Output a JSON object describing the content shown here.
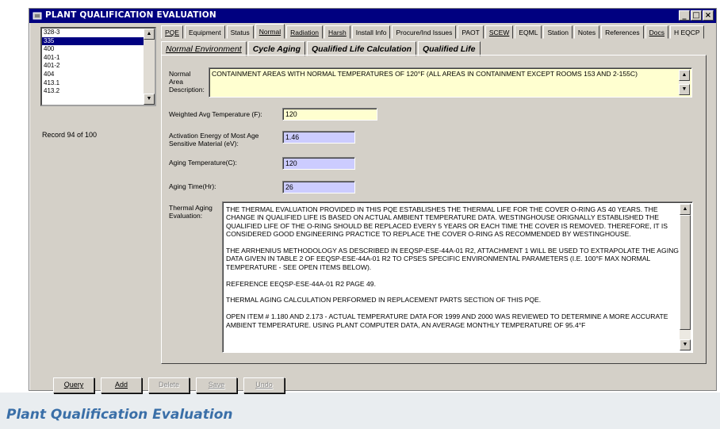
{
  "window": {
    "title": "PLANT QUALIFICATION EVALUATION",
    "controls": [
      "_",
      "□",
      "×"
    ]
  },
  "record_list": {
    "items": [
      "328-3",
      "335",
      "400",
      "401-1",
      "401-2",
      "404",
      "413.1",
      "413.2"
    ],
    "selected_index": 1,
    "record_status": "Record 94 of 100"
  },
  "tabs": [
    "PQE",
    "Equipment",
    "Status",
    "Normal",
    "Radiation",
    "Harsh",
    "Install Info",
    "Procure/Ind Issues",
    "PAOT",
    "SCEW",
    "EQML",
    "Station",
    "Notes",
    "References",
    "Docs",
    "H EQCP"
  ],
  "active_tab": "Normal",
  "subtabs": [
    "Normal Environment",
    "Cycle Aging",
    "Qualified Life Calculation",
    "Qualified Life"
  ],
  "active_subtab": "Normal Environment",
  "form": {
    "area_label": "Normal Area Description:",
    "area_value": "CONTAINMENT AREAS WITH NORMAL TEMPERATURES OF 120°F (ALL AREAS IN CONTAINMENT EXCEPT ROOMS 153 AND 2-155C)",
    "wavg_label": "Weighted Avg Temperature (F):",
    "wavg_value": "120",
    "activation_label_1": "Activation Energy of Most Age",
    "activation_label_2": "Sensitive Material (eV):",
    "activation_value": "1.46",
    "aging_temp_label": "Aging Temperature(C):",
    "aging_temp_value": "120",
    "aging_time_label": "Aging Time(Hr):",
    "aging_time_value": "26",
    "thermal_label_1": "Thermal Aging",
    "thermal_label_2": "Evaluation:",
    "thermal_paragraphs": [
      "THE THERMAL EVALUATION PROVIDED IN THIS PQE ESTABLISHES THE THERMAL LIFE FOR THE COVER O-RING AS 40 YEARS. THE CHANGE IN QUALIFIED LIFE IS BASED ON ACTUAL AMBIENT TEMPERATURE DATA.  WESTINGHOUSE ORIGNALLY ESTABLISHED THE QUALIFIED LIFE OF THE O-RING SHOULD BE REPLACED EVERY 5 YEARS OR EACH TIME THE COVER IS REMOVED. THEREFORE, IT IS CONSIDERED GOOD ENGINEERING PRACTICE TO REPLACE THE COVER O-RING AS RECOMMENDED BY WESTINGHOUSE.",
      "THE ARRHENIUS METHODOLOGY AS DESCRIBED IN EEQSP-ESE-44A-01 R2, ATTACHMENT 1 WILL BE USED TO EXTRAPOLATE THE AGING DATA GIVEN IN TABLE 2 OF EEQSP-ESE-44A-01 R2 TO CPSES SPECIFIC ENVIRONMENTAL PARAMETERS (I.E. 100°F MAX NORMAL TEMPERATURE - SEE OPEN ITEMS BELOW).",
      "REFERENCE EEQSP-ESE-44A-01 R2 PAGE 49.",
      "THERMAL AGING CALCULATION PERFORMED IN REPLACEMENT PARTS SECTION OF THIS PQE.",
      "OPEN ITEM # 1.180 AND 2.173 - ACTUAL TEMPERATURE DATA FOR 1999 AND 2000 WAS REVIEWED TO DETERMINE A MORE ACCURATE AMBIENT TEMPERATURE.  USING PLANT COMPUTER DATA, AN AVERAGE MONTHLY TEMPERATURE OF 95.4°F"
    ]
  },
  "buttons": {
    "query": "Query",
    "add": "Add",
    "delete": "Delete",
    "save": "Save",
    "undo": "Undo"
  },
  "caption": "Plant Qualification Evaluation",
  "colors": {
    "title_bar": "#000080",
    "yellow_field": "#ffffd0",
    "violet_field": "#ccccff",
    "caption": "#3a6fa8"
  }
}
